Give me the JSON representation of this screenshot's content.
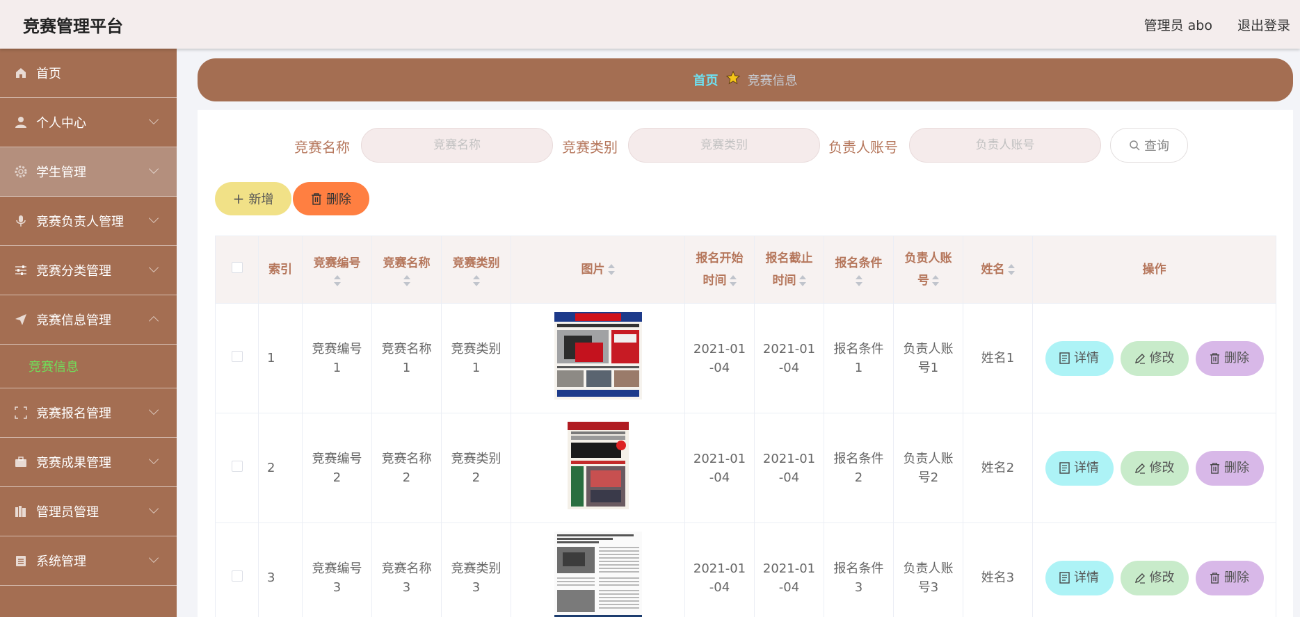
{
  "header": {
    "title": "竞赛管理平台",
    "admin": "管理员 abo",
    "logout": "退出登录"
  },
  "sidebar": {
    "items": [
      {
        "label": "首页",
        "icon": "home-icon"
      },
      {
        "label": "个人中心",
        "icon": "user-icon"
      },
      {
        "label": "学生管理",
        "icon": "gear-icon",
        "active": true
      },
      {
        "label": "竞赛负责人管理",
        "icon": "microphone-icon"
      },
      {
        "label": "竞赛分类管理",
        "icon": "sliders-icon"
      },
      {
        "label": "竞赛信息管理",
        "icon": "send-icon",
        "expanded": true
      },
      {
        "label": "竞赛信息",
        "submenu": true
      },
      {
        "label": "竞赛报名管理",
        "icon": "fullscreen-icon"
      },
      {
        "label": "竞赛成果管理",
        "icon": "suitcase-icon"
      },
      {
        "label": "管理员管理",
        "icon": "books-icon"
      },
      {
        "label": "系统管理",
        "icon": "clipboard-icon"
      }
    ]
  },
  "breadcrumb": {
    "home": "首页",
    "current": "竞赛信息"
  },
  "search": {
    "name_label": "竞赛名称",
    "name_placeholder": "竞赛名称",
    "category_label": "竞赛类别",
    "category_placeholder": "竞赛类别",
    "account_label": "负责人账号",
    "account_placeholder": "负责人账号",
    "query": "查询"
  },
  "actions": {
    "add": "新增",
    "delete": "删除"
  },
  "table": {
    "headers": {
      "index": "索引",
      "code": "竞赛编号",
      "name": "竞赛名称",
      "category": "竞赛类别",
      "image": "图片",
      "start_1": "报名开始",
      "start_2": "时间",
      "end_1": "报名截止",
      "end_2": "时间",
      "cond": "报名条件",
      "acct_1": "负责人账",
      "acct_2": "号",
      "person": "姓名",
      "ops": "操作"
    },
    "rows": [
      {
        "index": "1",
        "code_1": "竞赛编号",
        "code_2": "1",
        "name_1": "竞赛名称",
        "name_2": "1",
        "cat_1": "竞赛类别",
        "cat_2": "1",
        "start_1": "2021-01",
        "start_2": "-04",
        "end_1": "2021-01",
        "end_2": "-04",
        "cond_1": "报名条件",
        "cond_2": "1",
        "acct_1": "负责人账",
        "acct_2": "号1",
        "person": "姓名1"
      },
      {
        "index": "2",
        "code_1": "竞赛编号",
        "code_2": "2",
        "name_1": "竞赛名称",
        "name_2": "2",
        "cat_1": "竞赛类别",
        "cat_2": "2",
        "start_1": "2021-01",
        "start_2": "-04",
        "end_1": "2021-01",
        "end_2": "-04",
        "cond_1": "报名条件",
        "cond_2": "2",
        "acct_1": "负责人账",
        "acct_2": "号2",
        "person": "姓名2"
      },
      {
        "index": "3",
        "code_1": "竞赛编号",
        "code_2": "3",
        "name_1": "竞赛名称",
        "name_2": "3",
        "cat_1": "竞赛类别",
        "cat_2": "3",
        "start_1": "2021-01",
        "start_2": "-04",
        "end_1": "2021-01",
        "end_2": "-04",
        "cond_1": "报名条件",
        "cond_2": "3",
        "acct_1": "负责人账",
        "acct_2": "号3",
        "person": "姓名3"
      }
    ],
    "row_actions": {
      "detail": "详情",
      "edit": "修改",
      "delete": "删除"
    }
  },
  "colors": {
    "brown": "#a46e52",
    "active_menu": "#b48f7d",
    "submenu_text": "#6fe05a",
    "accent_text": "#b5765b",
    "add": "#f1e187",
    "delete": "#ff7f41",
    "detail": "#adf3f6",
    "edit": "#c8ebca",
    "row_delete": "#d8b8e8"
  }
}
